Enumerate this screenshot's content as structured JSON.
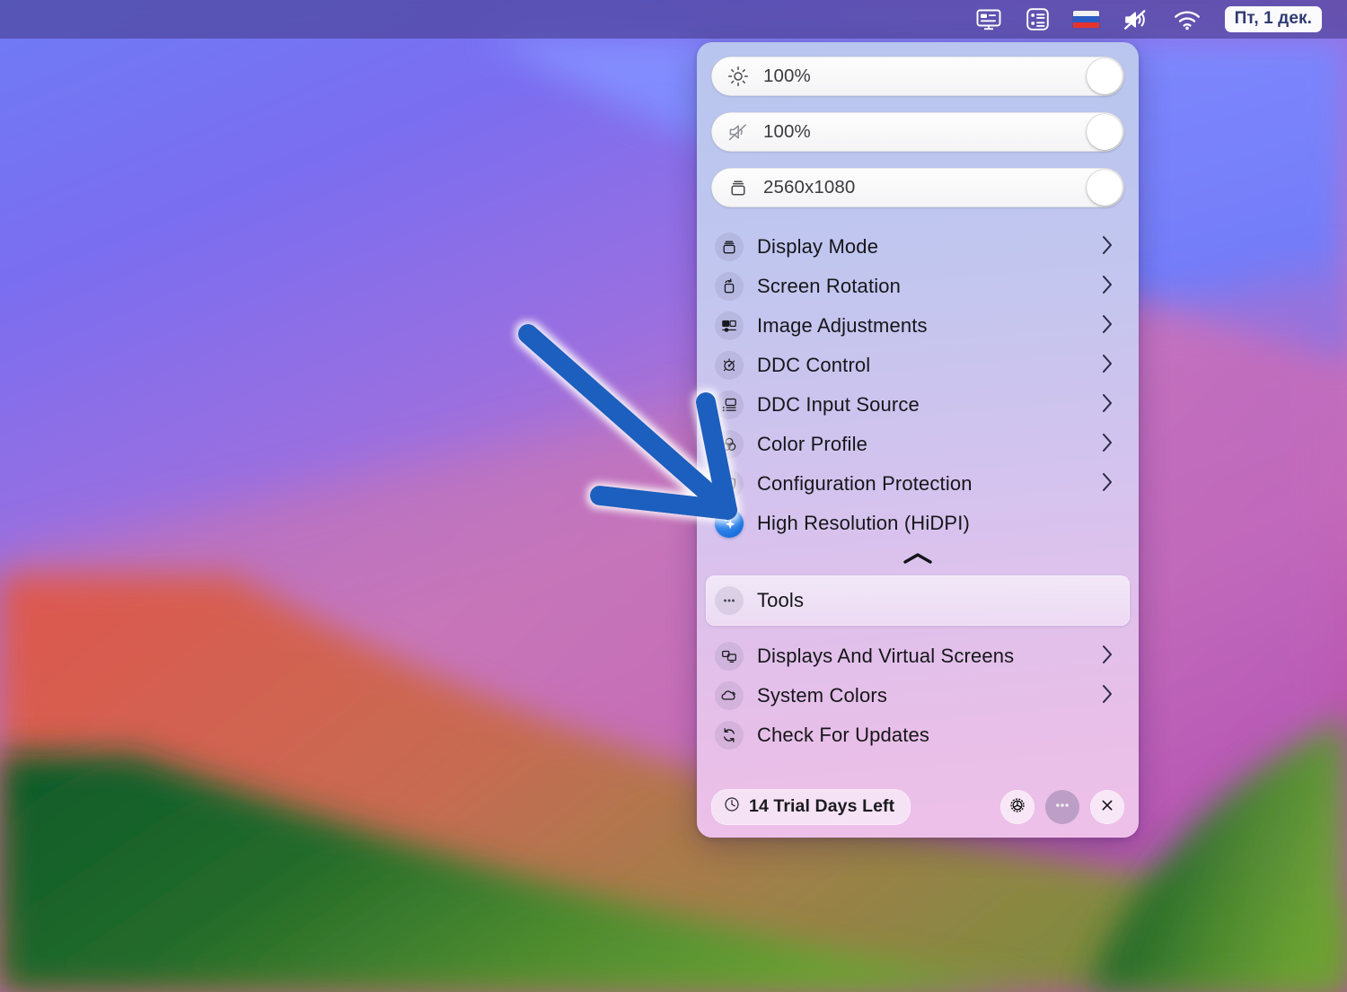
{
  "menubar": {
    "items": [
      {
        "name": "display-menu-icon",
        "icon": "display-icon"
      },
      {
        "name": "list-menu-icon",
        "icon": "list-icon"
      },
      {
        "name": "input-language-flag",
        "icon": "russian-flag-icon"
      },
      {
        "name": "volume-mute-icon",
        "icon": "speaker-mute-icon"
      },
      {
        "name": "wifi-icon",
        "icon": "wifi-icon"
      }
    ],
    "date": "Пт, 1 дек.",
    "flag_colors": [
      "#f5f5f7",
      "#2b5cc4",
      "#e8352c"
    ]
  },
  "panel": {
    "sliders": [
      {
        "icon": "brightness-icon",
        "value": "100%",
        "knob_position": "right"
      },
      {
        "icon": "volume-mute-icon",
        "value": "100%",
        "knob_position": "right"
      },
      {
        "icon": "resolution-icon",
        "value": "2560x1080",
        "knob_position": "right"
      }
    ],
    "menu_items": [
      {
        "label": "Display Mode",
        "icon": "display-mode-icon",
        "chevron": true,
        "active": false
      },
      {
        "label": "Screen Rotation",
        "icon": "rotate-icon",
        "chevron": true,
        "active": false
      },
      {
        "label": "Image Adjustments",
        "icon": "image-adjust-icon",
        "chevron": true,
        "active": false
      },
      {
        "label": "DDC Control",
        "icon": "ddc-control-icon",
        "chevron": true,
        "active": false
      },
      {
        "label": "DDC Input Source",
        "icon": "input-source-icon",
        "chevron": true,
        "active": false
      },
      {
        "label": "Color Profile",
        "icon": "color-profile-icon",
        "chevron": true,
        "active": false
      },
      {
        "label": "Configuration Protection",
        "icon": "shield-icon",
        "chevron": true,
        "active": false
      },
      {
        "label": "High Resolution (HiDPI)",
        "icon": "sparkle-icon",
        "chevron": false,
        "active": true
      }
    ],
    "collapse_icon": "chevron-up-icon",
    "tools_item": {
      "label": "Tools",
      "icon": "ellipsis-icon",
      "highlighted": true
    },
    "bottom_items": [
      {
        "label": "Displays And Virtual Screens",
        "icon": "displays-virtual-icon",
        "chevron": true
      },
      {
        "label": "System Colors",
        "icon": "system-colors-icon",
        "chevron": true
      },
      {
        "label": "Check For Updates",
        "icon": "refresh-icon",
        "chevron": false
      }
    ],
    "footer": {
      "trial_badge": {
        "label": "14 Trial Days Left",
        "icon": "clock-icon"
      },
      "buttons": [
        {
          "name": "settings-button",
          "icon": "gear-icon",
          "style": "light"
        },
        {
          "name": "more-button",
          "icon": "ellipsis-icon",
          "style": "dark"
        },
        {
          "name": "close-button",
          "icon": "close-icon",
          "style": "light"
        }
      ]
    }
  },
  "annotation": {
    "arrow": {
      "color": "#1b5fbe",
      "glow": "#ffffff",
      "points_to": "High Resolution (HiDPI)"
    }
  },
  "colors": {
    "panel_top": "#b8c5ee",
    "panel_bottom": "#eec0e9",
    "accent_blue": "#1c74e0",
    "menubar_bg": "rgba(70,62,140,0.60)",
    "text_primary": "#16161a"
  }
}
